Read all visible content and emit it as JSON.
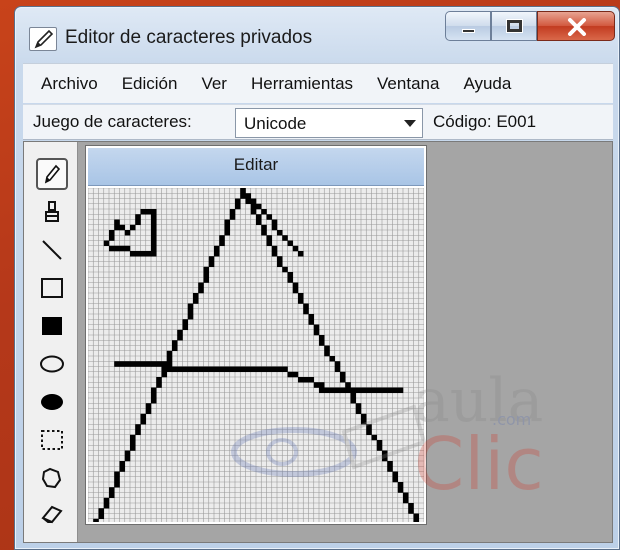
{
  "window": {
    "title": "Editor de caracteres privados",
    "icons": {
      "app": "pencil-app-icon",
      "minimize": "minimize-icon",
      "maximize": "maximize-icon",
      "close": "close-icon"
    }
  },
  "menu": {
    "items": [
      "Archivo",
      "Edición",
      "Ver",
      "Herramientas",
      "Ventana",
      "Ayuda"
    ]
  },
  "toolbar": {
    "charset_label": "Juego de caracteres:",
    "charset_value": "Unicode",
    "code_label": "Código: E001"
  },
  "tools": [
    {
      "name": "pencil",
      "icon": "pencil-icon",
      "active": true
    },
    {
      "name": "brush",
      "icon": "brush-icon"
    },
    {
      "name": "line",
      "icon": "line-icon"
    },
    {
      "name": "hollow-rectangle",
      "icon": "rectangle-outline-icon"
    },
    {
      "name": "filled-rectangle",
      "icon": "rectangle-filled-icon"
    },
    {
      "name": "hollow-ellipse",
      "icon": "ellipse-outline-icon"
    },
    {
      "name": "filled-ellipse",
      "icon": "ellipse-filled-icon"
    },
    {
      "name": "rect-selection",
      "icon": "rect-select-icon"
    },
    {
      "name": "freeform-selection",
      "icon": "freeform-select-icon"
    },
    {
      "name": "eraser",
      "icon": "eraser-icon"
    }
  ],
  "editor": {
    "header": "Editar"
  },
  "watermark": {
    "line1": "aula",
    "line2": "Clic",
    "small": ".com"
  },
  "colors": {
    "titlebar": "#c9d9ec",
    "close_button": "#c23b20",
    "editor_header": "#b4cdea"
  }
}
